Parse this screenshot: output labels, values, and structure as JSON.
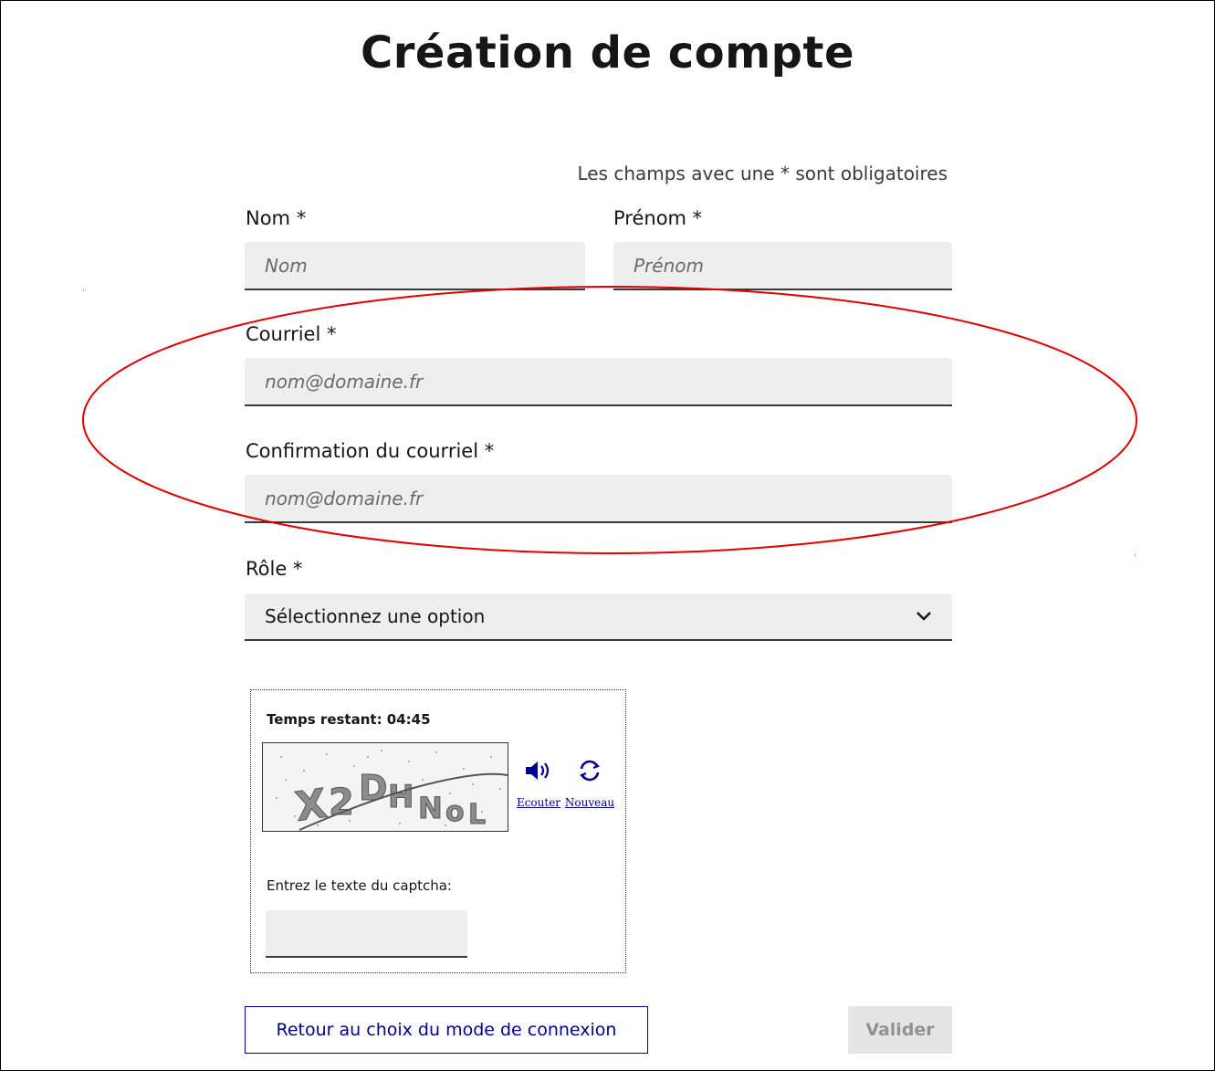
{
  "page": {
    "title": "Création de compte",
    "required_note": "Les champs avec une * sont obligatoires"
  },
  "form": {
    "nom": {
      "label": "Nom  *",
      "placeholder": "Nom",
      "value": ""
    },
    "prenom": {
      "label": "Prénom  *",
      "placeholder": "Prénom",
      "value": ""
    },
    "courriel": {
      "label": "Courriel  *",
      "placeholder": "nom@domaine.fr",
      "value": ""
    },
    "confirmation": {
      "label": "Confirmation du courriel  *",
      "placeholder": "nom@domaine.fr",
      "value": ""
    },
    "role": {
      "label": "Rôle  *",
      "selected": "Sélectionnez une option"
    }
  },
  "captcha": {
    "timer": "Temps restant: 04:45",
    "image_text": "X2DHNoL",
    "listen_label": "Ecouter",
    "new_label": "Nouveau",
    "prompt": "Entrez le texte du captcha:",
    "value": ""
  },
  "actions": {
    "back_label": "Retour au choix du mode de connexion",
    "submit_label": "Valider"
  },
  "colors": {
    "accent_blue": "#000091",
    "annotation_red": "#e00000",
    "input_bg": "#eeeeee"
  },
  "icons": {
    "listen": "speaker-icon",
    "refresh": "refresh-icon",
    "select": "chevron-down-icon"
  }
}
